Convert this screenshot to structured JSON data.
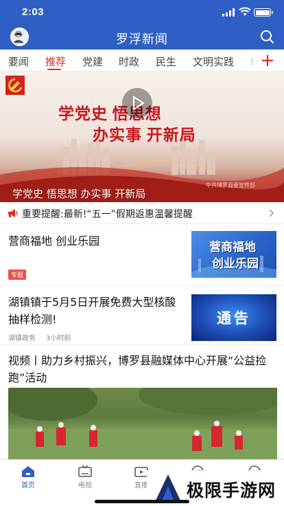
{
  "status_bar": {
    "time": "2:03"
  },
  "header": {
    "title": "罗浮新闻",
    "search_icon": "search-icon",
    "avatar_icon": "user-avatar-icon"
  },
  "tabs": {
    "items": [
      "要闻",
      "推荐",
      "党建",
      "时政",
      "民生",
      "文明实践",
      "新"
    ],
    "active": "推荐",
    "add_icon": "plus-icon"
  },
  "banner": {
    "slogan_line1": "学党史  悟思想",
    "slogan_line2": "办实事  开新局",
    "caption": "学党史 悟思想 办实事 开新局",
    "watermark": "中共博罗县委宣传部"
  },
  "notice": {
    "icon": "megaphone-icon",
    "text": "重要提醒:最新!“五一”假期返惠温馨提醒",
    "arrow_icon": "chevron-right-icon"
  },
  "articles": [
    {
      "title": "营商福地 创业乐园",
      "tag": "专题",
      "thumb_line1": "营商福地",
      "thumb_line2": "创业乐园"
    },
    {
      "title": "湖镇镇于5月5日开展免费大型核酸抽样检测!",
      "source": "湖镇政务",
      "time": "3小时前",
      "thumb_text": "通告"
    },
    {
      "title": "视频丨助力乡村振兴，博罗县融媒体中心开展“公益捡跑”活动",
      "media": "video",
      "play_icon": "play-icon"
    }
  ],
  "bottom_nav": {
    "items": [
      {
        "label": "首页",
        "icon": "home-icon"
      },
      {
        "label": "电视",
        "icon": "tv-icon"
      },
      {
        "label": "直播",
        "icon": "live-video-icon"
      },
      {
        "label": "",
        "icon": "compass-icon"
      },
      {
        "label": "",
        "icon": "message-icon"
      }
    ],
    "active": "首页"
  },
  "watermark": {
    "text": "极限手游网"
  },
  "colors": {
    "brand_blue": "#2f5fc4",
    "accent_red": "#e02b2b",
    "tag_red": "#e8534c"
  }
}
